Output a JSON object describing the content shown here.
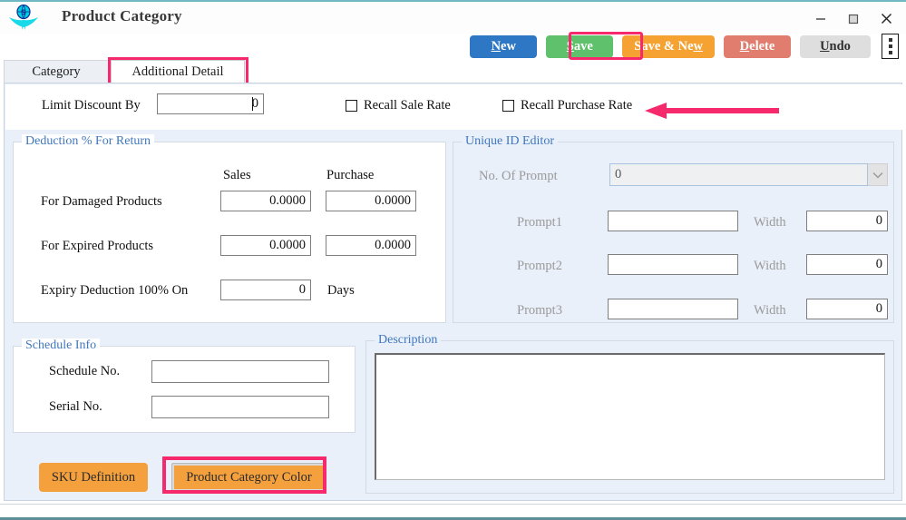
{
  "window": {
    "title": "Product Category",
    "logo_icon": "company-globe-logo",
    "controls": [
      {
        "name": "minimize",
        "icon": "minimize-icon"
      },
      {
        "name": "maximize",
        "icon": "maximize-icon"
      },
      {
        "name": "close",
        "icon": "close-icon"
      }
    ]
  },
  "toolbar": {
    "new": {
      "pre": "",
      "accel": "N",
      "post": "ew",
      "color": "#2e77c4"
    },
    "save": {
      "pre": "",
      "accel": "S",
      "post": "ave",
      "color": "#5fc16b"
    },
    "save_new": {
      "pre": "Save & Ne",
      "accel": "w",
      "post": "",
      "color": "#f6a233"
    },
    "delete": {
      "pre": "",
      "accel": "D",
      "post": "elete",
      "color": "#e07d6e"
    },
    "undo": {
      "pre": "",
      "accel": "U",
      "post": "ndo",
      "color": "#dedede"
    },
    "overflow_icon": "kebab-menu-icon"
  },
  "tabs": [
    {
      "label": "Category",
      "active": false
    },
    {
      "label": "Additional Detail",
      "active": true
    }
  ],
  "top_row": {
    "limit_discount_label": "Limit Discount By",
    "limit_discount_value": "0",
    "recall_sale_rate": {
      "label": "Recall Sale Rate",
      "checked": false
    },
    "recall_purchase_rate": {
      "label": "Recall Purchase Rate",
      "checked": false
    }
  },
  "deduction": {
    "title": "Deduction % For Return",
    "col_sales": "Sales",
    "col_purchase": "Purchase",
    "rows": [
      {
        "label": "For Damaged Products",
        "sales": "0.0000",
        "purchase": "0.0000"
      },
      {
        "label": "For Expired Products",
        "sales": "0.0000",
        "purchase": "0.0000"
      }
    ],
    "expiry_label": "Expiry Deduction 100% On",
    "expiry_value": "0",
    "expiry_unit": "Days"
  },
  "unique_id_editor": {
    "title": "Unique ID Editor",
    "no_of_prompt_label": "No. Of Prompt",
    "no_of_prompt_value": "0",
    "width_label": "Width",
    "prompts": [
      {
        "label": "Prompt1",
        "value": "",
        "width": "0"
      },
      {
        "label": "Prompt2",
        "value": "",
        "width": "0"
      },
      {
        "label": "Prompt3",
        "value": "",
        "width": "0"
      }
    ]
  },
  "schedule_info": {
    "title": "Schedule Info",
    "schedule_no_label": "Schedule No.",
    "schedule_no_value": "",
    "serial_no_label": "Serial No.",
    "serial_no_value": ""
  },
  "description": {
    "title": "Description",
    "value": ""
  },
  "bottom_buttons": {
    "sku_definition": "SKU Definition",
    "product_category_color": "Product Category Color"
  },
  "annotations": {
    "highlight_color": "#f5296b",
    "arrow_target": "Recall Purchase Rate",
    "highlighted": [
      "Additional Detail tab",
      "Save button",
      "Product Category Color button"
    ]
  }
}
